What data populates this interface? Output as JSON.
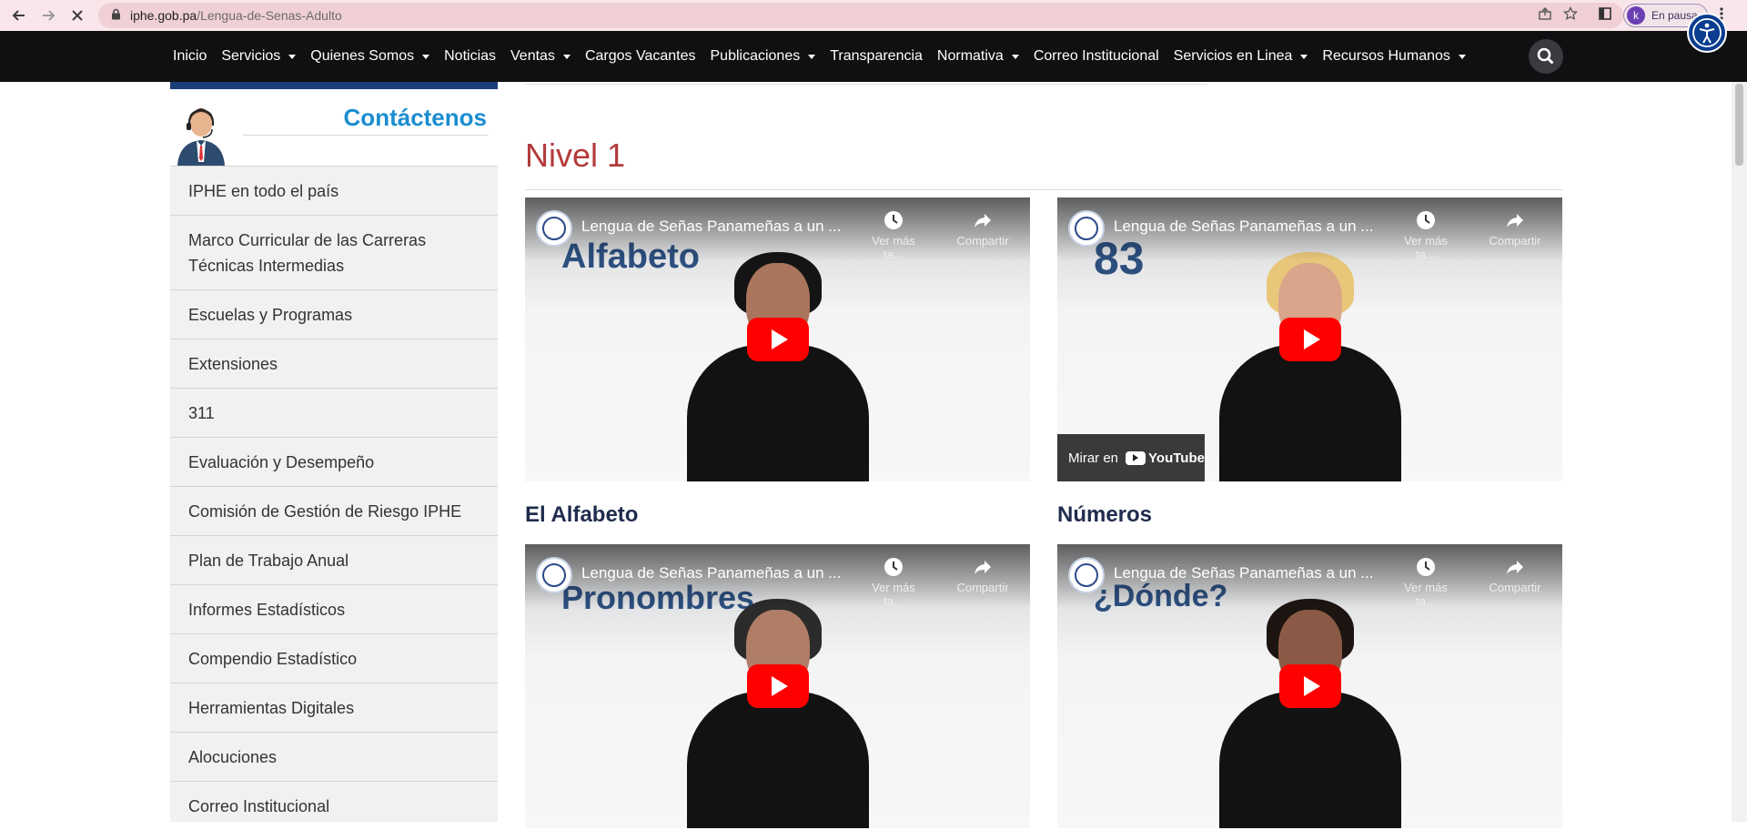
{
  "browser": {
    "url_host": "iphe.gob.pa",
    "url_path": "/Lengua-de-Senas-Adulto",
    "profile_initial": "k",
    "profile_status": "En pausa"
  },
  "nav": {
    "items": [
      {
        "label": "Inicio",
        "dropdown": false
      },
      {
        "label": "Servicios",
        "dropdown": true
      },
      {
        "label": "Quienes Somos",
        "dropdown": true
      },
      {
        "label": "Noticias",
        "dropdown": false
      },
      {
        "label": "Ventas",
        "dropdown": true
      },
      {
        "label": "Cargos Vacantes",
        "dropdown": false
      },
      {
        "label": "Publicaciones",
        "dropdown": true
      },
      {
        "label": "Transparencia",
        "dropdown": false
      },
      {
        "label": "Normativa",
        "dropdown": true
      },
      {
        "label": "Correo Institucional",
        "dropdown": false
      },
      {
        "label": "Servicios en Linea",
        "dropdown": true
      },
      {
        "label": "Recursos Humanos",
        "dropdown": true
      }
    ]
  },
  "sidebar": {
    "contact_title": "Contáctenos",
    "items": [
      "IPHE en todo el país",
      "Marco Curricular de las Carreras Técnicas Intermedias",
      "Escuelas y Programas",
      "Extensiones",
      "311",
      "Evaluación y Desempeño",
      "Comisión de Gestión de Riesgo IPHE",
      "Plan de Trabajo Anual",
      "Informes Estadísticos",
      "Compendio Estadístico",
      "Herramientas Digitales",
      "Alocuciones",
      "Correo Institucional"
    ]
  },
  "main": {
    "level_title": "Nivel 1",
    "videos": [
      {
        "title": "Lengua de Señas Panameñas a un ...",
        "overlay": "Alfabeto",
        "caption": "El Alfabeto",
        "watch_later": "Ver más ta...",
        "share": "Compartir"
      },
      {
        "title": "Lengua de Señas Panameñas a un ...",
        "overlay": "83",
        "caption": "Números",
        "watch_later": "Ver más ta...",
        "share": "Compartir",
        "watch_on": "Mirar en",
        "youtube": "YouTube"
      },
      {
        "title": "Lengua de Señas Panameñas a un ...",
        "overlay": "Pronombres",
        "caption": "",
        "watch_later": "Ver más ta...",
        "share": "Compartir"
      },
      {
        "title": "Lengua de Señas Panameñas a un ...",
        "overlay": "¿Dónde?",
        "caption": "",
        "watch_later": "Ver más ta...",
        "share": "Compartir"
      }
    ]
  },
  "colors": {
    "nav_bg": "#0f1012",
    "level_title": "#b43a3a",
    "contact_title": "#1b8dd0",
    "youtube_red": "#ff0000"
  }
}
